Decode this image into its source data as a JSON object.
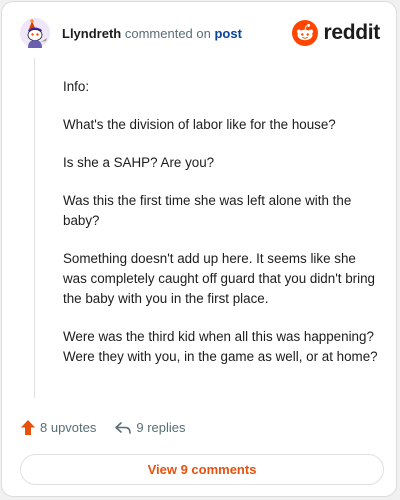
{
  "header": {
    "username": "Llyndreth",
    "action_text": "commented on",
    "post_link": "post"
  },
  "brand": {
    "wordmark": "reddit",
    "color": "#ff4500"
  },
  "comment": {
    "paragraphs": [
      "Info:",
      "What's the division of labor like for the house?",
      "Is she a SAHP? Are you?",
      "Was this the first time she was left alone with the baby?",
      "Something doesn't add up here. It seems like she was completely caught off guard that you didn't bring the baby with you in the first place.",
      "Were was the third kid when all this was happening? Were they with you, in the game as well, or at home?"
    ]
  },
  "footer": {
    "upvotes": "8 upvotes",
    "replies": "9 replies",
    "upvote_icon": "upvote-arrow-icon",
    "reply_icon": "reply-arrow-icon",
    "accent": "#e8510d"
  },
  "view_button": {
    "label": "View 9 comments"
  }
}
